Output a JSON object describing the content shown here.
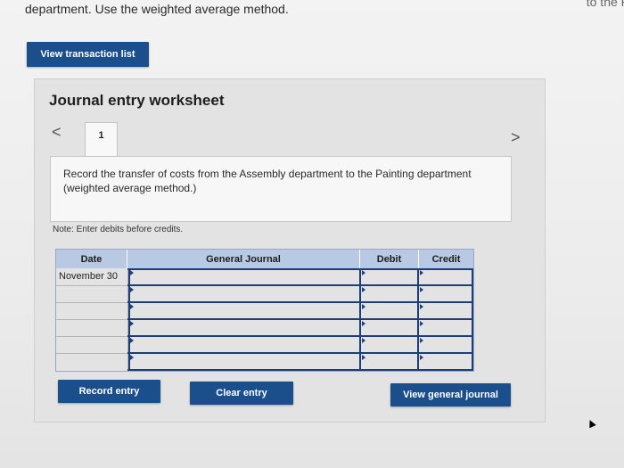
{
  "intro": {
    "text": "department. Use the weighted average method.",
    "cut_text": "to the P"
  },
  "buttons": {
    "view_transaction_list": "View transaction list",
    "record_entry": "Record entry",
    "clear_entry": "Clear entry",
    "view_general_journal": "View general journal"
  },
  "worksheet": {
    "title": "Journal entry worksheet",
    "tab_number": "1",
    "prev_arrow": "<",
    "next_arrow": ">",
    "instruction": "Record the transfer of costs from the Assembly department to the Painting department (weighted average method.)",
    "note": "Note: Enter debits before credits."
  },
  "table": {
    "headers": [
      "Date",
      "General Journal",
      "Debit",
      "Credit"
    ],
    "rows": [
      {
        "date": "November 30",
        "account": "",
        "debit": "",
        "credit": ""
      },
      {
        "date": "",
        "account": "",
        "debit": "",
        "credit": ""
      },
      {
        "date": "",
        "account": "",
        "debit": "",
        "credit": ""
      },
      {
        "date": "",
        "account": "",
        "debit": "",
        "credit": ""
      },
      {
        "date": "",
        "account": "",
        "debit": "",
        "credit": ""
      },
      {
        "date": "",
        "account": "",
        "debit": "",
        "credit": ""
      }
    ]
  },
  "colors": {
    "button_bg": "#1a4f8c",
    "header_bg": "#b7c9e3",
    "input_border": "#1c3f7a"
  }
}
